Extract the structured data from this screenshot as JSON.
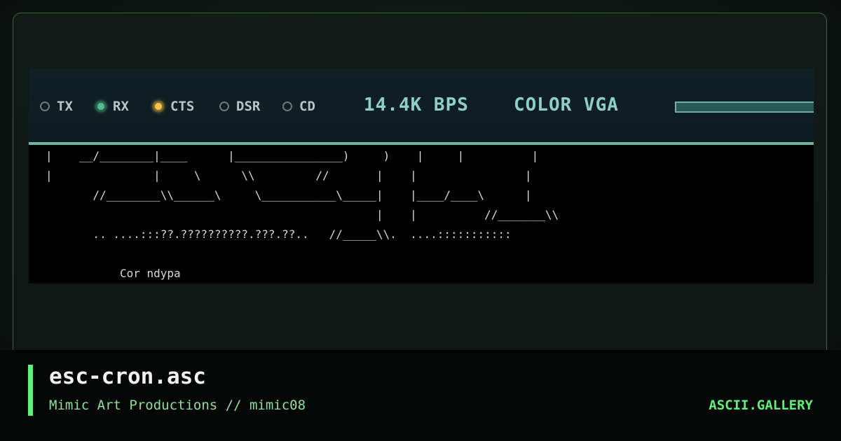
{
  "status_bar": {
    "indicators": [
      {
        "label": "TX",
        "state": "off"
      },
      {
        "label": "RX",
        "state": "on",
        "color": "#4fc08e"
      },
      {
        "label": "CTS",
        "state": "on",
        "color": "#f4c84d"
      },
      {
        "label": "DSR",
        "state": "off"
      },
      {
        "label": "CD",
        "state": "off"
      }
    ],
    "baud_rate": "14.4K BPS",
    "display_mode": "COLOR VGA"
  },
  "ascii_art": {
    "lines": [
      "|    __/________|____      |________________)     )    |     |          |",
      "|               |     \\      \\\\         //       |    |                |",
      "       //________\\\\______\\     \\___________\\_____|    |____/____\\      |",
      "                                                 |    |          //_______\\\\",
      "       .. ....:::??.??????????.???.??..   //_____\\\\.  ....:::::::::::",
      "",
      "           Cor ndypa"
    ]
  },
  "footer": {
    "title": "esc-cron.asc",
    "subtitle": "Mimic Art Productions // mimic08",
    "brand": "ASCII.GALLERY"
  },
  "colors": {
    "accent": "#5ef07a",
    "frame_border": "#2f6a3c",
    "status_text": "#8fd0c4"
  }
}
